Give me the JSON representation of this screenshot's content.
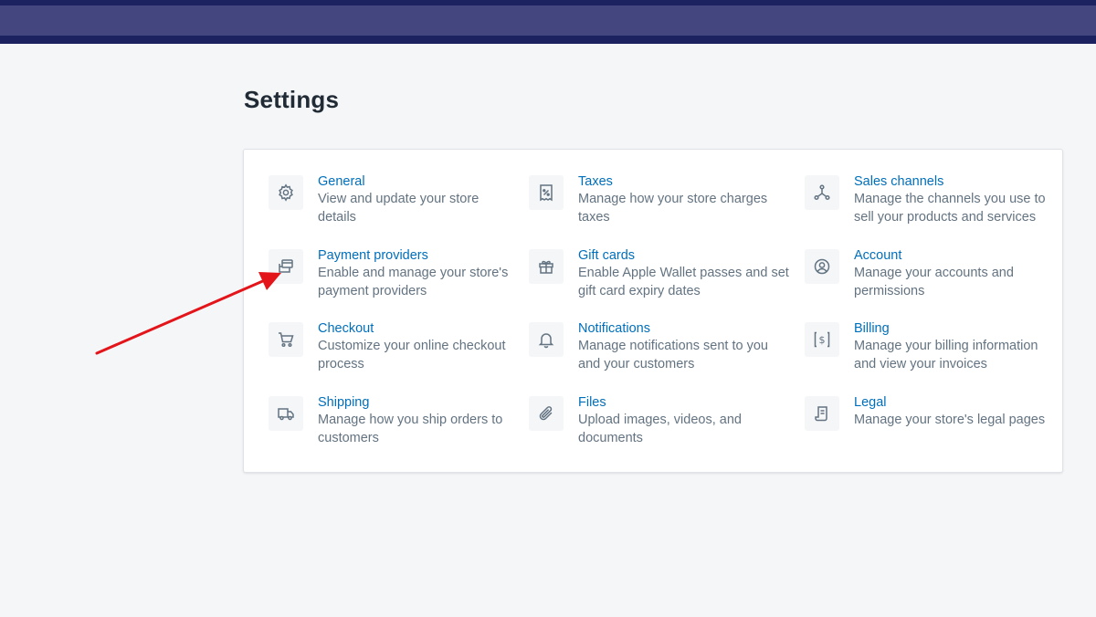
{
  "header": {
    "title": "Settings"
  },
  "settings": [
    {
      "title": "General",
      "desc_1": "View and update your store",
      "desc_2": "details",
      "icon": "gear-icon"
    },
    {
      "title": "Taxes",
      "desc_1": "Manage how your store charges",
      "desc_2": "taxes",
      "icon": "tax-receipt-icon"
    },
    {
      "title": "Sales channels",
      "desc_1": "Manage the channels you use to",
      "desc_2": "sell your products and services",
      "icon": "channels-icon"
    },
    {
      "title": "Payment providers",
      "desc_1": "Enable and manage your store's",
      "desc_2": "payment providers",
      "icon": "payment-icon"
    },
    {
      "title": "Gift cards",
      "desc_1": "Enable Apple Wallet passes and set",
      "desc_2": "gift card expiry dates",
      "icon": "gift-icon"
    },
    {
      "title": "Account",
      "desc_1": "Manage your accounts and",
      "desc_2": "permissions",
      "icon": "account-icon"
    },
    {
      "title": "Checkout",
      "desc_1": "Customize your online checkout",
      "desc_2": "process",
      "icon": "cart-icon"
    },
    {
      "title": "Notifications",
      "desc_1": "Manage notifications sent to you",
      "desc_2": "and your customers",
      "icon": "bell-icon"
    },
    {
      "title": "Billing",
      "desc_1": "Manage your billing information",
      "desc_2": "and view your invoices",
      "icon": "billing-icon"
    },
    {
      "title": "Shipping",
      "desc_1": "Manage how you ship orders to",
      "desc_2": "customers",
      "icon": "truck-icon"
    },
    {
      "title": "Files",
      "desc_1": "Upload images, videos, and",
      "desc_2": "documents",
      "icon": "paperclip-icon"
    },
    {
      "title": "Legal",
      "desc_1": "Manage your store's legal pages",
      "desc_2": "",
      "icon": "legal-document-icon"
    }
  ],
  "colors": {
    "topbar": "#43467f",
    "topbar_border": "#1c2260",
    "link": "#006fbb",
    "muted": "#637381",
    "annotation_arrow": "#e3151a"
  }
}
